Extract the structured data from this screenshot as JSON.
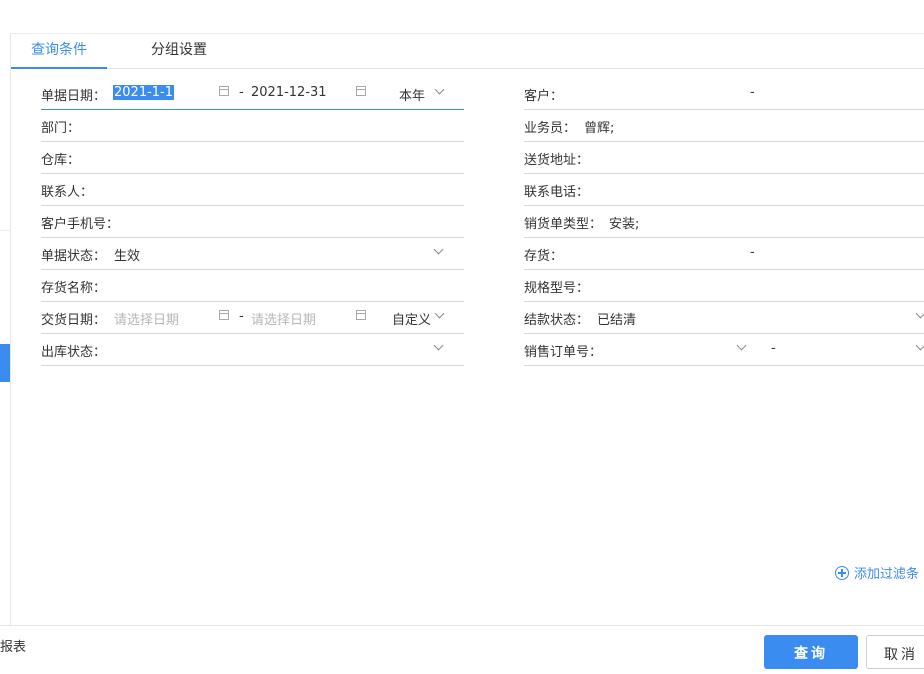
{
  "tabs": [
    {
      "label": "查询条件",
      "active": true
    },
    {
      "label": "分组设置",
      "active": false
    }
  ],
  "left_fields": {
    "doc_date": {
      "label": "单据日期：",
      "from": "2021-1-1",
      "sep": "-",
      "to": "2021-12-31",
      "preset": "本年"
    },
    "dept": {
      "label": "部门："
    },
    "warehouse": {
      "label": "仓库："
    },
    "contact": {
      "label": "联系人："
    },
    "cust_mobile": {
      "label": "客户手机号："
    },
    "doc_status": {
      "label": "单据状态：",
      "value": "生效"
    },
    "inv_name": {
      "label": "存货名称："
    },
    "delivery_date": {
      "label": "交货日期：",
      "from_placeholder": "请选择日期",
      "sep": "-",
      "to_placeholder": "请选择日期",
      "preset": "自定义"
    },
    "out_status": {
      "label": "出库状态："
    }
  },
  "right_fields": {
    "customer": {
      "label": "客户：",
      "sep": "-"
    },
    "salesperson": {
      "label": "业务员：",
      "value": "曾辉;"
    },
    "ship_addr": {
      "label": "送货地址："
    },
    "contact_phone": {
      "label": "联系电话："
    },
    "sales_type": {
      "label": "销货单类型：",
      "value": "安装;"
    },
    "inventory": {
      "label": "存货：",
      "sep": "-"
    },
    "spec": {
      "label": "规格型号："
    },
    "settle_status": {
      "label": "结款状态：",
      "value": "已结清"
    },
    "sales_order": {
      "label": "销售订单号：",
      "sep": "-"
    }
  },
  "add_filter": "添加过滤条",
  "footer": {
    "left_text": "报表",
    "query": "查询",
    "cancel": "取消"
  },
  "colors": {
    "accent": "#3b8cf0",
    "line": "#d9d9d9"
  },
  "icons": [
    "calendar-icon",
    "chevron-down-icon",
    "plus-circle-icon"
  ]
}
